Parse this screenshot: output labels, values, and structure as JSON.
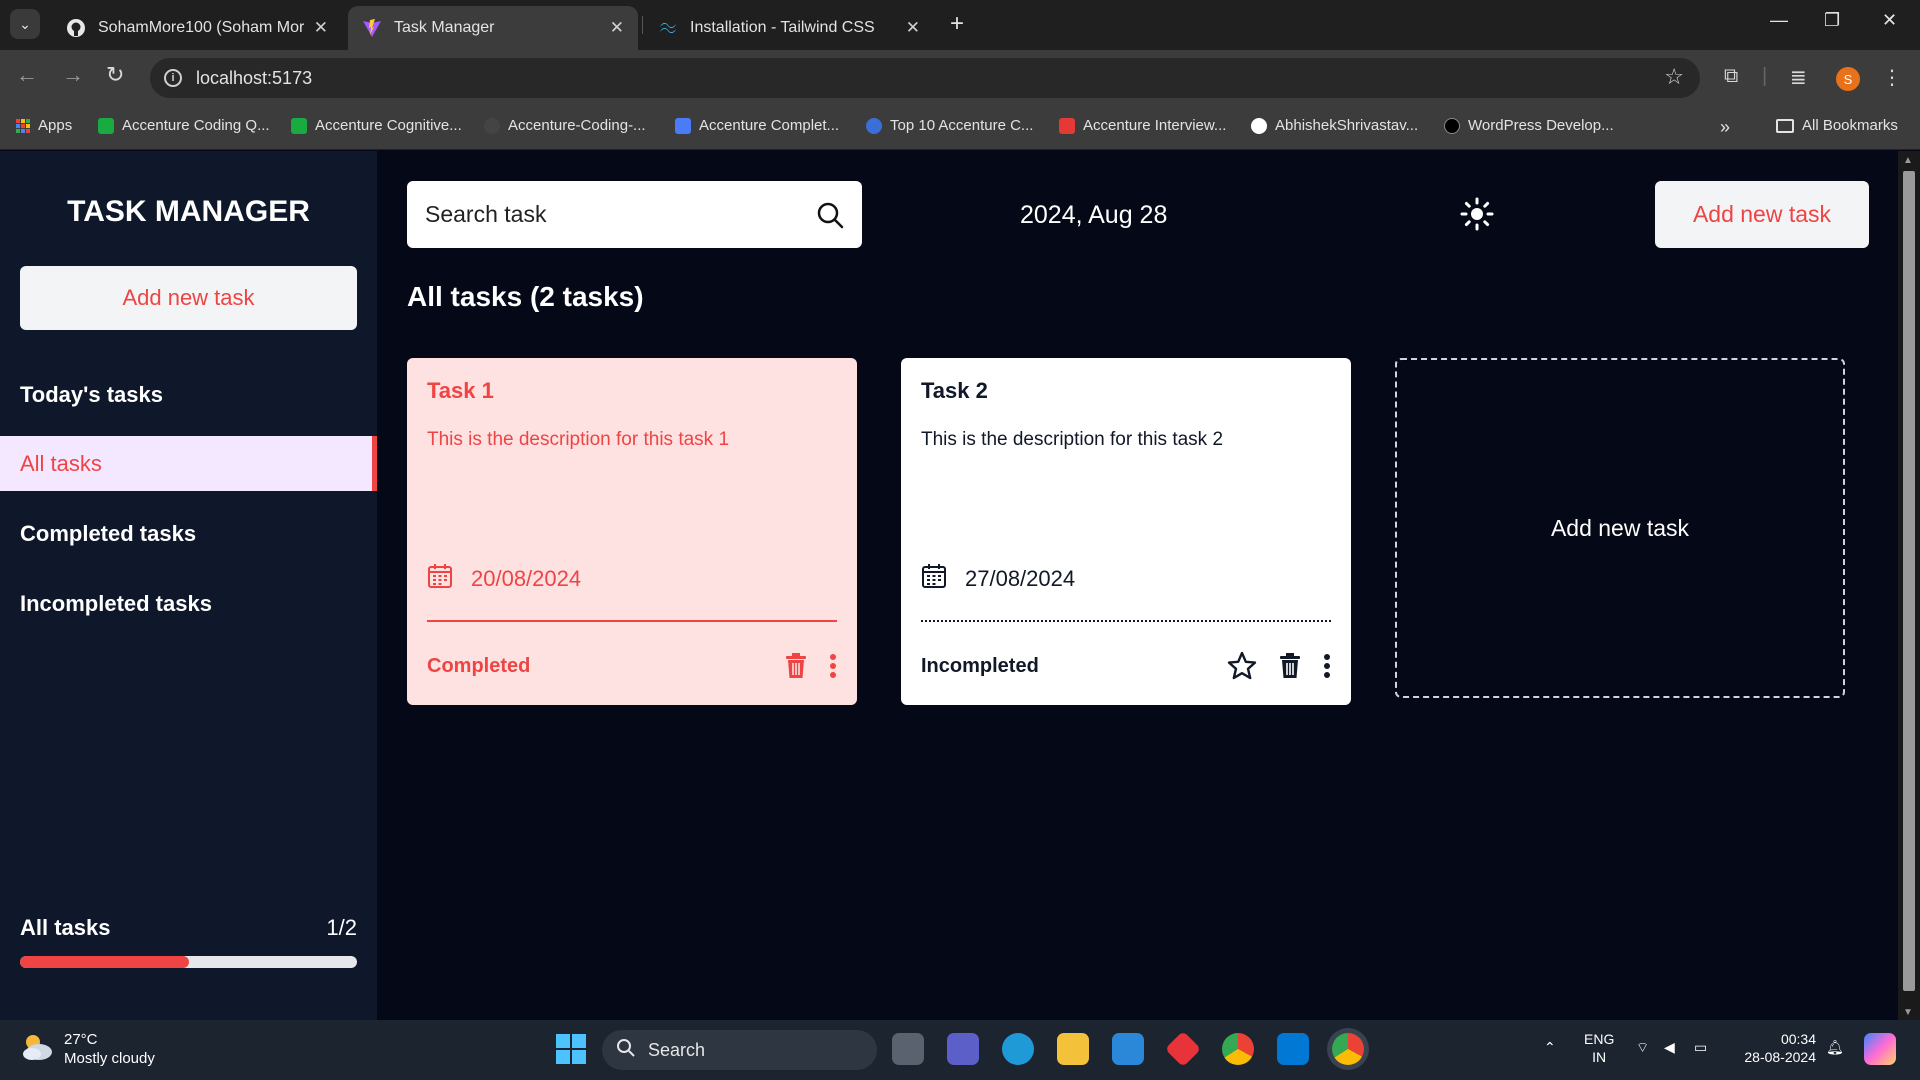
{
  "browser": {
    "tabs": [
      {
        "title": "SohamMore100 (Soham More)",
        "icon": "github-icon"
      },
      {
        "title": "Task Manager",
        "icon": "vite-icon"
      },
      {
        "title": "Installation - Tailwind CSS",
        "icon": "tailwind-icon"
      }
    ],
    "url": "localhost:5173",
    "profile_initial": "S",
    "bookmarks": [
      {
        "label": "Apps",
        "color": "#ea4335"
      },
      {
        "label": "Accenture Coding Q...",
        "color": "#1aab40"
      },
      {
        "label": "Accenture Cognitive...",
        "color": "#1aab40"
      },
      {
        "label": "Accenture-Coding-...",
        "color": "#444444"
      },
      {
        "label": "Accenture Complet...",
        "color": "#4a7cf7"
      },
      {
        "label": "Top 10 Accenture C...",
        "color": "#3b6fd8"
      },
      {
        "label": "Accenture Interview...",
        "color": "#e53935"
      },
      {
        "label": "AbhishekShrivastav...",
        "color": "#ffffff"
      },
      {
        "label": "WordPress Develop...",
        "color": "#000000"
      }
    ],
    "all_bookmarks": "All Bookmarks"
  },
  "sidebar": {
    "title": "TASK MANAGER",
    "add_button": "Add new task",
    "menu": [
      {
        "label": "Today's tasks",
        "active": false
      },
      {
        "label": "All tasks",
        "active": true
      },
      {
        "label": "Completed tasks",
        "active": false
      },
      {
        "label": "Incompleted tasks",
        "active": false
      }
    ],
    "progress": {
      "label": "All tasks",
      "count": "1/2",
      "fraction": 0.5
    }
  },
  "main": {
    "search_placeholder": "Search task",
    "date": "2024, Aug 28",
    "add_button": "Add new task",
    "heading": "All tasks (2 tasks)",
    "tasks": [
      {
        "title": "Task 1",
        "description": "This is the description for this task 1",
        "date": "20/08/2024",
        "status": "Completed"
      },
      {
        "title": "Task 2",
        "description": "This is the description for this task 2",
        "date": "27/08/2024",
        "status": "Incompleted"
      }
    ],
    "add_card_label": "Add new task"
  },
  "colors": {
    "accent": "#ef4444",
    "sidebar_bg": "#0f172a",
    "main_bg": "#050816"
  },
  "taskbar": {
    "weather_temp": "27°C",
    "weather_desc": "Mostly cloudy",
    "search_label": "Search",
    "lang_1": "ENG",
    "lang_2": "IN",
    "time": "00:34",
    "date": "28-08-2024"
  }
}
